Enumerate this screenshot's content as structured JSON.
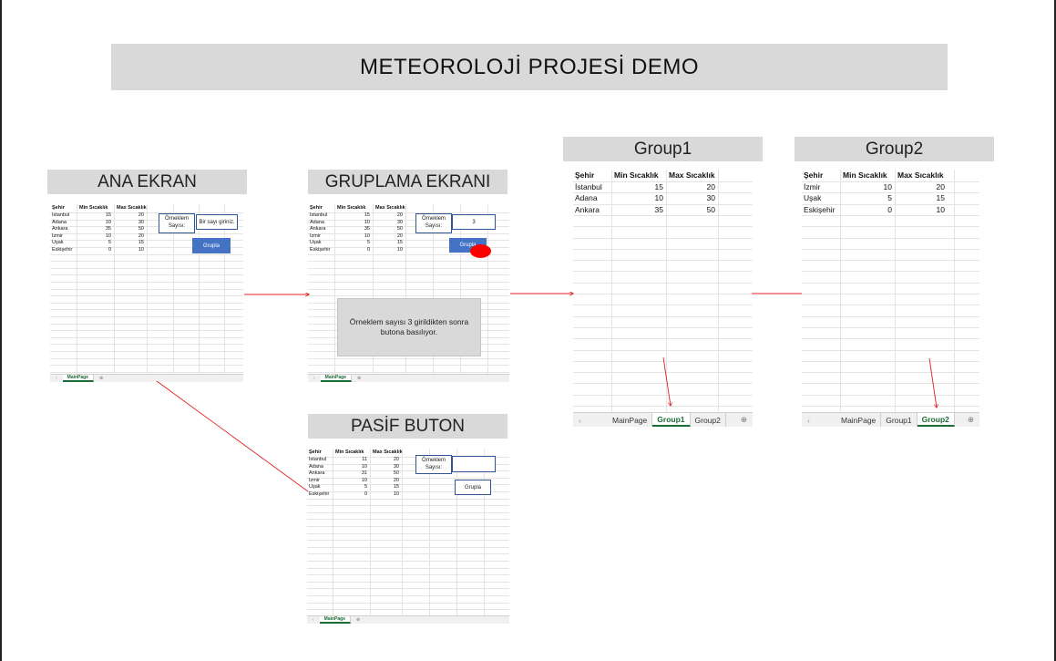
{
  "title": "METEOROLOJİ PROJESİ DEMO",
  "labels": {
    "ana": "ANA EKRAN",
    "gruplama": "GRUPLAMA EKRANI",
    "pasif": "PASİF BUTON",
    "group1": "Group1",
    "group2": "Group2"
  },
  "columns": [
    "Şehir",
    "Min Sıcaklık",
    "Max Sıcaklık"
  ],
  "main_rows": [
    [
      "İstanbul",
      "15",
      "20"
    ],
    [
      "Adana",
      "10",
      "30"
    ],
    [
      "Ankara",
      "35",
      "50"
    ],
    [
      "İzmir",
      "10",
      "20"
    ],
    [
      "Uşak",
      "5",
      "15"
    ],
    [
      "Eskişehir",
      "0",
      "10"
    ]
  ],
  "pasif_rows": [
    [
      "İstanbul",
      "11",
      "20"
    ],
    [
      "Adana",
      "10",
      "30"
    ],
    [
      "Ankara",
      "31",
      "50"
    ],
    [
      "İzmir",
      "10",
      "20"
    ],
    [
      "Uşak",
      "5",
      "15"
    ],
    [
      "Eskişehir",
      "0",
      "10"
    ]
  ],
  "group1_rows": [
    [
      "İstanbul",
      "15",
      "20"
    ],
    [
      "Adana",
      "10",
      "30"
    ],
    [
      "Ankara",
      "35",
      "50"
    ]
  ],
  "group2_rows": [
    [
      "İzmir",
      "10",
      "20"
    ],
    [
      "Uşak",
      "5",
      "15"
    ],
    [
      "Eskişehir",
      "0",
      "10"
    ]
  ],
  "controls": {
    "sample_label": "Örneklem Sayısı:",
    "input_placeholder": "Bir sayı giriniz.",
    "input_value": "3",
    "group_button": "Grupla"
  },
  "note": "Örneklem sayısı 3 girildikten sonra butona basılıyor.",
  "tabs": {
    "main": "MainPage",
    "group1": "Group1",
    "group2": "Group2",
    "add": "⊕",
    "nav": "‹"
  },
  "colors": {
    "arrow": "#e02020",
    "button": "#4472c4",
    "active_tab": "#1b6b34",
    "click_marker": "#ff0000"
  }
}
